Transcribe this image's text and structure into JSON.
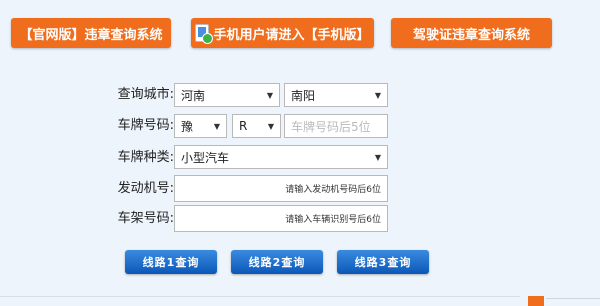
{
  "top_buttons": {
    "official": "【官网版】违章查询系统",
    "mobile": "手机用户请进入【手机版】",
    "license": "驾驶证违章查询系统"
  },
  "form": {
    "city_label": "查询城市:",
    "province": "河南",
    "city": "南阳",
    "plate_label": "车牌号码:",
    "plate_prefix": "豫",
    "plate_letter": "R",
    "plate_placeholder": "车牌号码后5位",
    "type_label": "车牌种类:",
    "type_value": "小型汽车",
    "engine_label": "发动机号:",
    "engine_hint": "请输入发动机号码后6位",
    "frame_label": "车架号码:",
    "frame_hint": "请输入车辆识别号后6位"
  },
  "query_buttons": [
    "线路1查询",
    "线路2查询",
    "线路3查询"
  ],
  "colors": {
    "orange": "#ef6d1d",
    "blue": "#0b57b8",
    "background": "#edf4fb"
  }
}
